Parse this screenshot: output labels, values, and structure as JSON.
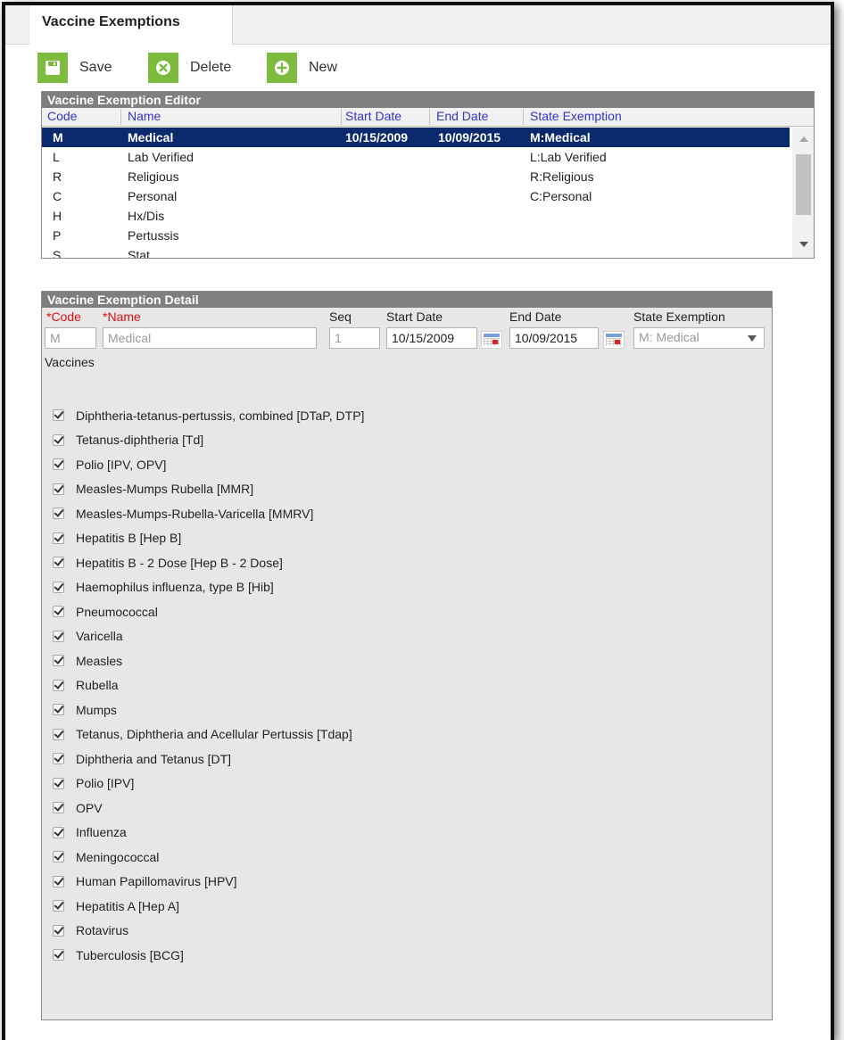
{
  "tab": {
    "title": "Vaccine Exemptions"
  },
  "toolbar": {
    "save_label": "Save",
    "delete_label": "Delete",
    "new_label": "New"
  },
  "editor": {
    "title": "Vaccine Exemption Editor",
    "columns": {
      "code": "Code",
      "name": "Name",
      "start_date": "Start Date",
      "end_date": "End Date",
      "state_exemption": "State Exemption"
    },
    "rows": [
      {
        "code": "M",
        "name": "Medical",
        "start_date": "10/15/2009",
        "end_date": "10/09/2015",
        "state_exemption": "M:Medical",
        "selected": true
      },
      {
        "code": "L",
        "name": "Lab Verified",
        "start_date": "",
        "end_date": "",
        "state_exemption": "L:Lab Verified"
      },
      {
        "code": "R",
        "name": "Religious",
        "start_date": "",
        "end_date": "",
        "state_exemption": "R:Religious"
      },
      {
        "code": "C",
        "name": "Personal",
        "start_date": "",
        "end_date": "",
        "state_exemption": "C:Personal"
      },
      {
        "code": "H",
        "name": "Hx/Dis",
        "start_date": "",
        "end_date": "",
        "state_exemption": ""
      },
      {
        "code": "P",
        "name": "Pertussis",
        "start_date": "",
        "end_date": "",
        "state_exemption": ""
      },
      {
        "code": "S",
        "name": "Stat",
        "start_date": "",
        "end_date": "",
        "state_exemption": ""
      }
    ]
  },
  "detail": {
    "title": "Vaccine Exemption Detail",
    "labels": {
      "code": "*Code",
      "name": "*Name",
      "seq": "Seq",
      "start_date": "Start Date",
      "end_date": "End Date",
      "state_exemption": "State Exemption",
      "vaccines": "Vaccines"
    },
    "values": {
      "code": "M",
      "name": "Medical",
      "seq": "1",
      "start_date": "10/15/2009",
      "end_date": "10/09/2015",
      "state_exemption": "M: Medical"
    },
    "vaccines": [
      {
        "label": "Diphtheria-tetanus-pertussis, combined [DTaP, DTP]",
        "checked": true
      },
      {
        "label": "Tetanus-diphtheria [Td]",
        "checked": true
      },
      {
        "label": "Polio [IPV, OPV]",
        "checked": true
      },
      {
        "label": "Measles-Mumps Rubella [MMR]",
        "checked": true
      },
      {
        "label": "Measles-Mumps-Rubella-Varicella [MMRV]",
        "checked": true
      },
      {
        "label": "Hepatitis B [Hep B]",
        "checked": true
      },
      {
        "label": "Hepatitis B - 2 Dose [Hep B - 2 Dose]",
        "checked": true
      },
      {
        "label": "Haemophilus influenza, type B [Hib]",
        "checked": true
      },
      {
        "label": "Pneumococcal",
        "checked": true
      },
      {
        "label": "Varicella",
        "checked": true
      },
      {
        "label": "Measles",
        "checked": true
      },
      {
        "label": "Rubella",
        "checked": true
      },
      {
        "label": "Mumps",
        "checked": true
      },
      {
        "label": "Tetanus, Diphtheria and Acellular Pertussis [Tdap]",
        "checked": true
      },
      {
        "label": "Diphtheria and Tetanus [DT]",
        "checked": true
      },
      {
        "label": "Polio [IPV]",
        "checked": true
      },
      {
        "label": "OPV",
        "checked": true
      },
      {
        "label": "Influenza",
        "checked": true
      },
      {
        "label": "Meningococcal",
        "checked": true
      },
      {
        "label": "Human Papillomavirus [HPV]",
        "checked": true
      },
      {
        "label": "Hepatitis A [Hep A]",
        "checked": true
      },
      {
        "label": "Rotavirus",
        "checked": true
      },
      {
        "label": "Tuberculosis [BCG]",
        "checked": true
      }
    ]
  },
  "colors": {
    "toolbar_icon": "#7dbb3e",
    "selected_row": "#0b2a6e",
    "column_header_text": "#3434c8",
    "required_label": "#dd1111",
    "section_header": "#7f7f7f"
  }
}
